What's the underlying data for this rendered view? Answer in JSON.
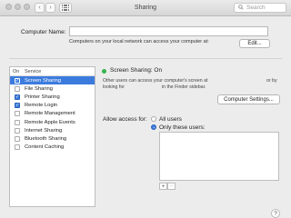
{
  "window": {
    "title": "Sharing"
  },
  "toolbar": {
    "back_icon": "chevron-left",
    "forward_icon": "chevron-right",
    "grid_icon": "grid-icon",
    "search_placeholder": "Search"
  },
  "computer_name": {
    "label": "Computer Name:",
    "value": "",
    "note": "Computers on your local network can access your computer at:",
    "edit_label": "Edit..."
  },
  "services": {
    "header_on": "On",
    "header_service": "Service",
    "items": [
      {
        "label": "Screen Sharing",
        "checked": true,
        "selected": true
      },
      {
        "label": "File Sharing",
        "checked": false,
        "selected": false
      },
      {
        "label": "Printer Sharing",
        "checked": true,
        "selected": false
      },
      {
        "label": "Remote Login",
        "checked": true,
        "selected": false
      },
      {
        "label": "Remote Management",
        "checked": false,
        "selected": false
      },
      {
        "label": "Remote Apple Events",
        "checked": false,
        "selected": false
      },
      {
        "label": "Internet Sharing",
        "checked": false,
        "selected": false
      },
      {
        "label": "Bluetooth Sharing",
        "checked": false,
        "selected": false
      },
      {
        "label": "Content Caching",
        "checked": false,
        "selected": false
      }
    ]
  },
  "detail": {
    "status": "Screen Sharing: On",
    "status_color": "#37b34a",
    "desc_line1": "Other users can access your computer's screen at",
    "desc_line1_end": "or by",
    "desc_line2a": "looking for",
    "desc_line2b": "in the Finder sidebar.",
    "computer_settings_label": "Computer Settings...",
    "allow_access_label": "Allow access for:",
    "all_users_label": "All users",
    "only_users_label": "Only these users:",
    "add_label": "+",
    "remove_label": "−"
  },
  "help": {
    "label": "?"
  },
  "accent_color": "#3c7bde"
}
